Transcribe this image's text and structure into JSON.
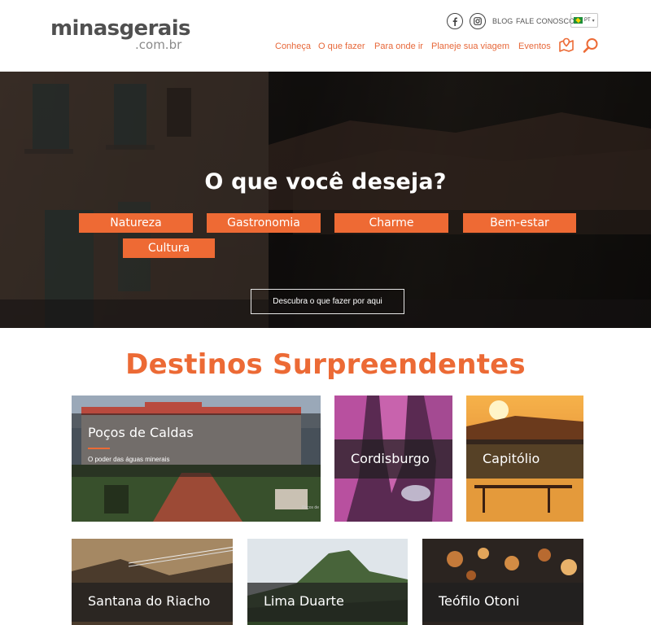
{
  "header": {
    "logo_main": "minasgerais",
    "logo_sub": ".com.br",
    "social": [
      "facebook-icon",
      "instagram-icon"
    ],
    "blog": "BLOG",
    "contact": "FALE CONOSCO",
    "language": "PT",
    "nav": [
      "Conheça",
      "O que fazer",
      "Para onde ir",
      "Planeje sua viagem",
      "Eventos"
    ]
  },
  "hero": {
    "title": "O que você deseja?",
    "categories": [
      "Natureza",
      "Gastronomia",
      "Charme",
      "Bem-estar",
      "Cultura"
    ],
    "cta": "Descubra o que fazer por aqui"
  },
  "destinations": {
    "title": "Destinos Surpreendentes",
    "cards": [
      {
        "name": "Poços de Caldas",
        "subtitle": "O poder das águas minerais",
        "credit": "Poços de"
      },
      {
        "name": "Cordisburgo"
      },
      {
        "name": "Capitólio"
      },
      {
        "name": "Santana do Riacho"
      },
      {
        "name": "Lima Duarte"
      },
      {
        "name": "Teófilo Otoni"
      }
    ]
  },
  "colors": {
    "accent": "#ec6a35",
    "text_dark": "#505050",
    "overlay": "#1e1e1e"
  }
}
